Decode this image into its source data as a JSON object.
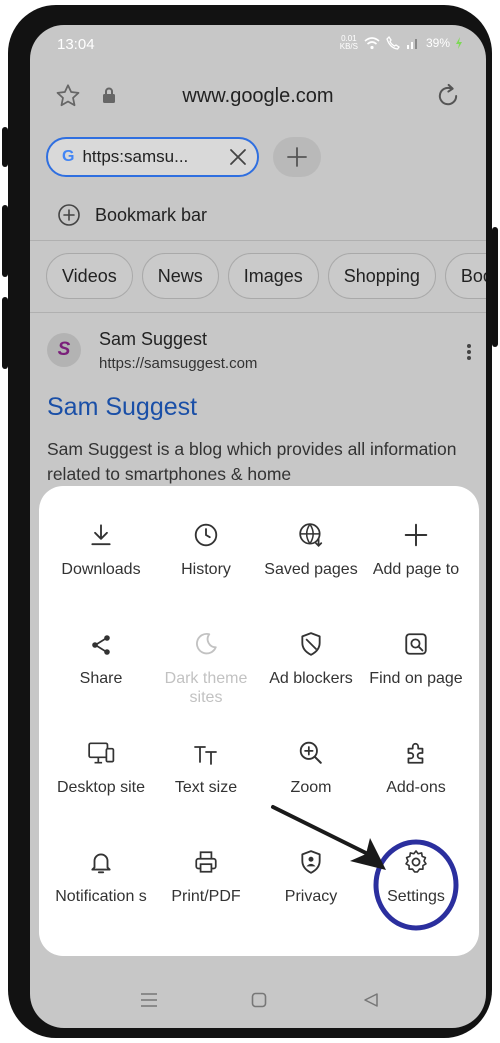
{
  "status_bar": {
    "time": "13:04",
    "speed_value": "0.01",
    "speed_unit": "KB/S",
    "battery": "39%"
  },
  "url_bar": {
    "url": "www.google.com",
    "star_icon": "star-icon",
    "lock_icon": "lock-icon",
    "reload_icon": "reload-icon"
  },
  "tab": {
    "favicon_letter": "G",
    "title": "https:samsu...",
    "close_icon": "close-icon"
  },
  "new_tab_icon": "plus-icon",
  "bookmark_bar": {
    "label": "Bookmark bar",
    "icon": "add-circle-icon"
  },
  "filter_chips": [
    "Videos",
    "News",
    "Images",
    "Shopping",
    "Boo"
  ],
  "result": {
    "favicon_letter": "S",
    "site_name": "Sam Suggest",
    "site_url": "https://samsuggest.com",
    "title": "Sam Suggest",
    "description": "Sam Suggest is a blog which provides all information related to smartphones & home"
  },
  "menu": {
    "items": [
      {
        "label": "Downloads",
        "icon": "download-icon",
        "disabled": false
      },
      {
        "label": "History",
        "icon": "clock-icon",
        "disabled": false
      },
      {
        "label": "Saved pages",
        "icon": "saved-pages-icon",
        "disabled": false
      },
      {
        "label": "Add page to",
        "icon": "plus-icon",
        "disabled": false
      },
      {
        "label": "Share",
        "icon": "share-icon",
        "disabled": false
      },
      {
        "label": "Dark theme sites",
        "icon": "moon-icon",
        "disabled": true
      },
      {
        "label": "Ad blockers",
        "icon": "shield-icon",
        "disabled": false
      },
      {
        "label": "Find on page",
        "icon": "find-icon",
        "disabled": false
      },
      {
        "label": "Desktop site",
        "icon": "desktop-icon",
        "disabled": false
      },
      {
        "label": "Text size",
        "icon": "text-size-icon",
        "disabled": false
      },
      {
        "label": "Zoom",
        "icon": "zoom-icon",
        "disabled": false
      },
      {
        "label": "Add-ons",
        "icon": "puzzle-icon",
        "disabled": false
      },
      {
        "label": "Notification s",
        "icon": "bell-icon",
        "disabled": false
      },
      {
        "label": "Print/PDF",
        "icon": "printer-icon",
        "disabled": false
      },
      {
        "label": "Privacy",
        "icon": "privacy-shield-icon",
        "disabled": false
      },
      {
        "label": "Settings",
        "icon": "gear-icon",
        "disabled": false
      }
    ]
  },
  "annotation": {
    "highlight_color": "#2b2f9e",
    "arrow_color": "#1a1a1a"
  },
  "nav_bar": {
    "recents_icon": "recents-icon",
    "home_icon": "home-icon",
    "back_icon": "back-icon"
  },
  "colors": {
    "link": "#1a4fa7",
    "tab_border": "#2f6fe0",
    "screen_dim": "#c7c7c7"
  }
}
